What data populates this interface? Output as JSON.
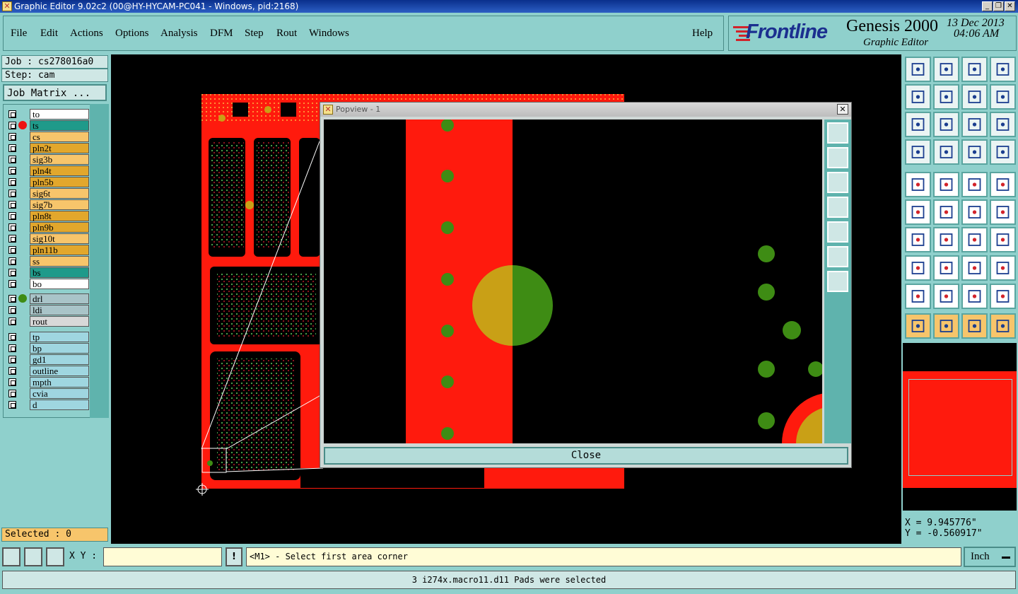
{
  "window": {
    "title": "Graphic Editor 9.02c2 (00@HY-HYCAM-PC041 - Windows, pid:2168)"
  },
  "menu": {
    "items": [
      "File",
      "Edit",
      "Actions",
      "Options",
      "Analysis",
      "DFM",
      "Step",
      "Rout",
      "Windows"
    ],
    "help": "Help"
  },
  "brand": {
    "logo": "Frontline",
    "product": "Genesis 2000",
    "subtitle": "Graphic Editor",
    "date": "13 Dec 2013",
    "time": "04:06 AM"
  },
  "job": {
    "job_label": "Job : cs278016a0",
    "step_label": "Step: cam",
    "matrix_button": "Job Matrix ..."
  },
  "layers": {
    "board": [
      {
        "name": "to",
        "color": "#ffffff"
      },
      {
        "name": "ts",
        "color": "#1f9a8a"
      },
      {
        "name": "cs",
        "color": "#f7c56b"
      },
      {
        "name": "pln2t",
        "color": "#e2a72c"
      },
      {
        "name": "sig3b",
        "color": "#f7c56b"
      },
      {
        "name": "pln4t",
        "color": "#e2a72c"
      },
      {
        "name": "pln5b",
        "color": "#e2a72c"
      },
      {
        "name": "sig6t",
        "color": "#f7c56b"
      },
      {
        "name": "sig7b",
        "color": "#f7c56b"
      },
      {
        "name": "pln8t",
        "color": "#e2a72c"
      },
      {
        "name": "pln9b",
        "color": "#e2a72c"
      },
      {
        "name": "sig10t",
        "color": "#f7c56b"
      },
      {
        "name": "pln11b",
        "color": "#e2a72c"
      },
      {
        "name": "ss",
        "color": "#f7c56b"
      },
      {
        "name": "bs",
        "color": "#1f9a8a"
      },
      {
        "name": "bo",
        "color": "#ffffff"
      }
    ],
    "drill": [
      {
        "name": "drl",
        "color": "#a9c4c8"
      },
      {
        "name": "ldi",
        "color": "#a9c4c8"
      },
      {
        "name": "rout",
        "color": "#d8d8d8"
      }
    ],
    "misc": [
      {
        "name": "tp",
        "color": "#9fd6e0"
      },
      {
        "name": "bp",
        "color": "#9fd6e0"
      },
      {
        "name": "gd1",
        "color": "#9fd6e0"
      },
      {
        "name": "outline",
        "color": "#9fd6e0"
      },
      {
        "name": "mpth",
        "color": "#9fd6e0"
      },
      {
        "name": "cvia",
        "color": "#9fd6e0"
      },
      {
        "name": "d",
        "color": "#9fd6e0"
      }
    ]
  },
  "selected": {
    "label": "Selected : 0"
  },
  "popview": {
    "title": "Popview - 1",
    "close_label": "Close"
  },
  "coords": {
    "x": "X = 9.945776\"",
    "y": "Y = -0.560917\""
  },
  "bottom": {
    "xy_label": "X Y :",
    "xy_value": "",
    "prompt": "<M1> - Select first area corner",
    "units": "Inch",
    "status": "3 i274x.macro11.d11 Pads were selected"
  },
  "colors": {
    "panel": "#8fd0cc",
    "copper": "#ff1a0d",
    "pad": "#3e8c14",
    "highlight": "#c9a016"
  }
}
